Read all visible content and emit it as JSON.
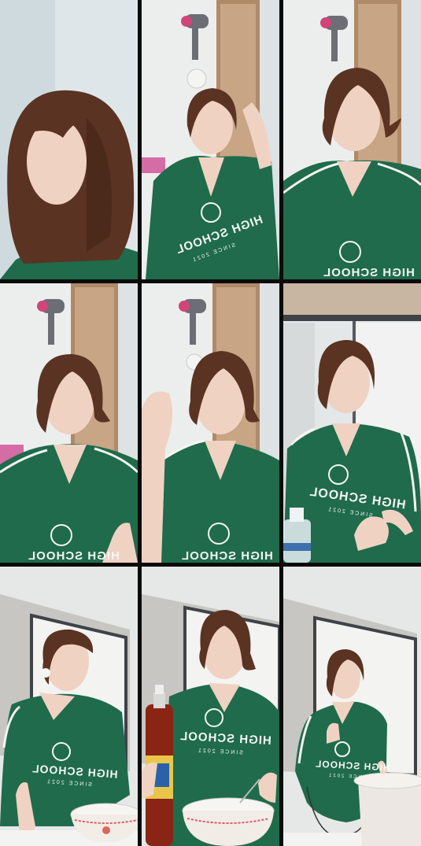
{
  "collage": {
    "layout": "3x3 grid of video frames",
    "frames": [
      {
        "scene": "close-up, hair down"
      },
      {
        "scene": "hair dryer on wall, adjusting hair"
      },
      {
        "scene": "hair dryer on wall, talking"
      },
      {
        "scene": "hair dryer on wall, talking"
      },
      {
        "scene": "hair dryer on wall, hand raised"
      },
      {
        "scene": "kitchen, holding water bottle"
      },
      {
        "scene": "kitchen, bowl on counter"
      },
      {
        "scene": "kitchen, sauce bottle and bowl"
      },
      {
        "scene": "kitchen, pot on counter"
      }
    ]
  },
  "shirt": {
    "text_main": "HIGH SCHOOL",
    "text_sub": "SINCE 2021"
  },
  "colors": {
    "shirt_green": "#1f6b4b",
    "shirt_green_dark": "#17553b",
    "hair_brown": "#5a3322",
    "skin": "#f0d2c2",
    "wall": "#e9ecee",
    "frame_border": "#0b0b0b"
  }
}
